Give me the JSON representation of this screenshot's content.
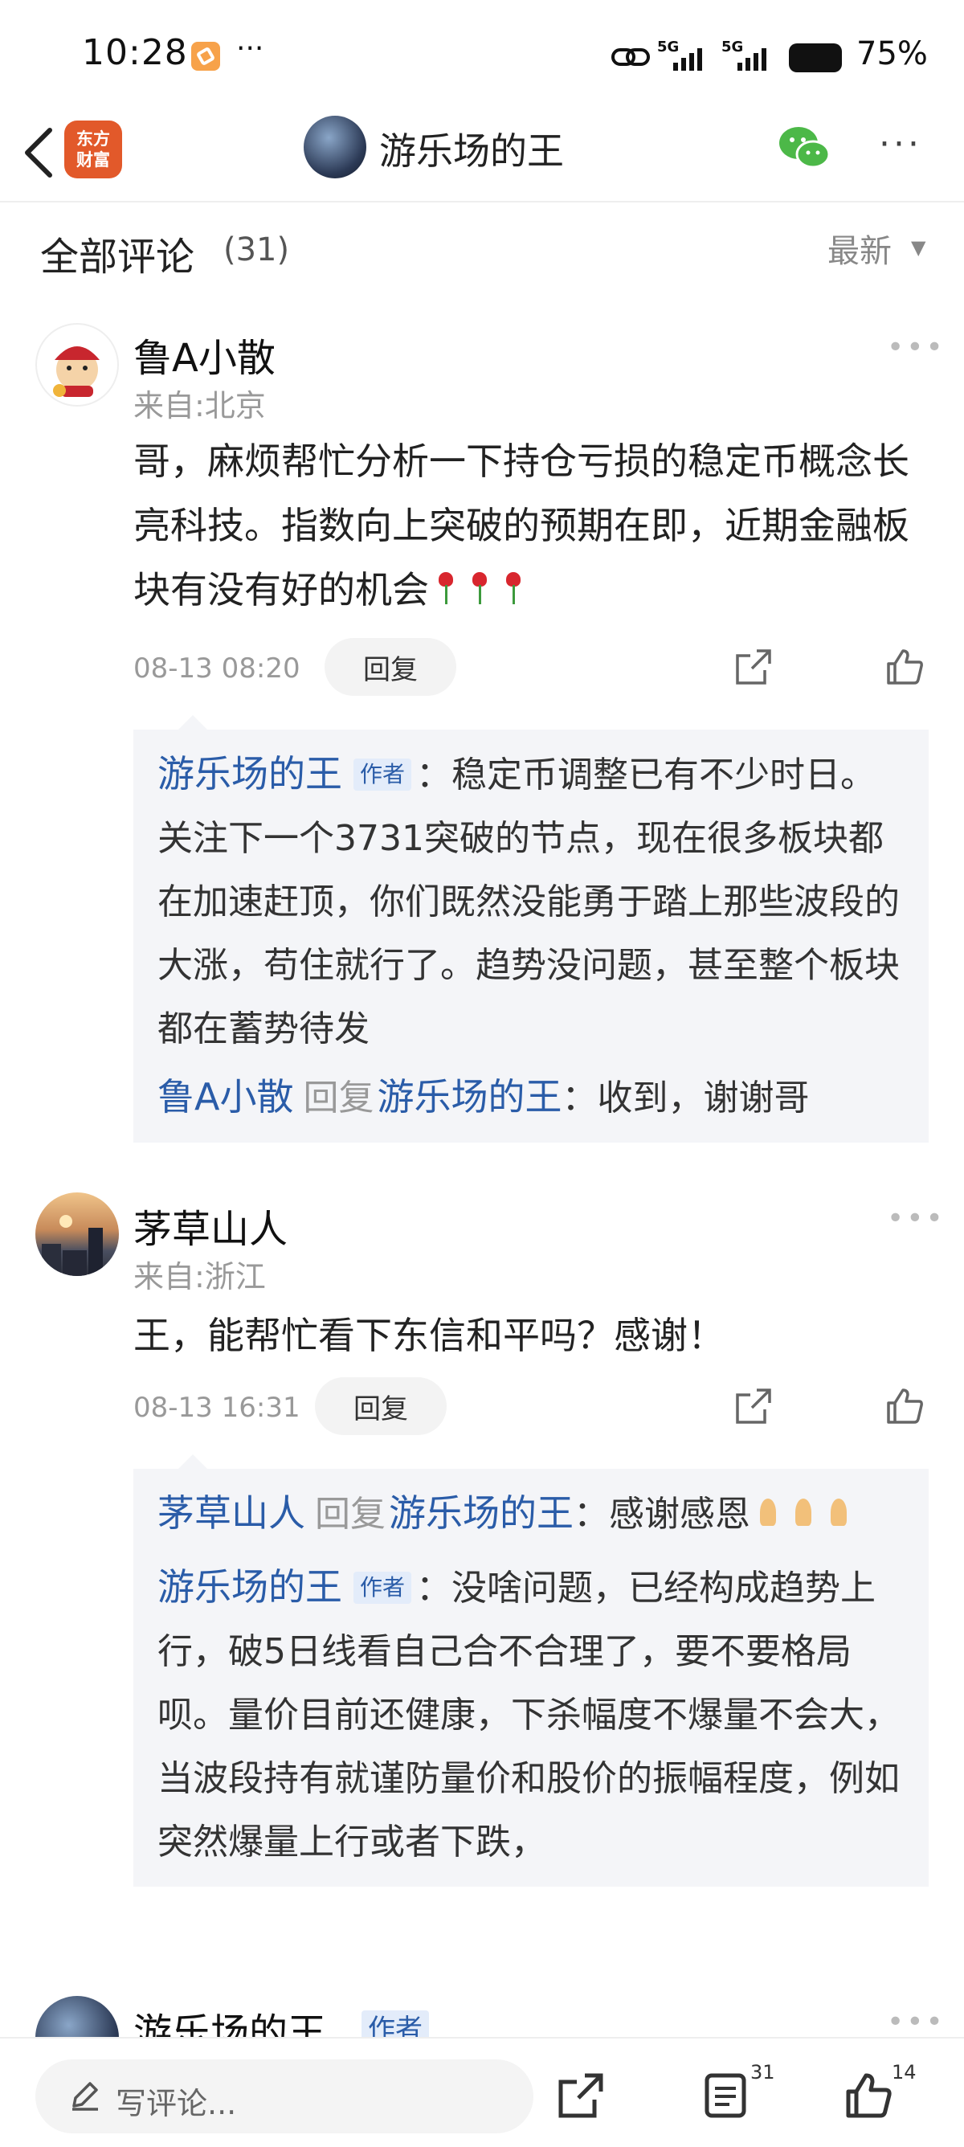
{
  "status_bar": {
    "time": "10:28",
    "more": "···",
    "signal1": "5G",
    "signal2": "5G",
    "battery": "75%"
  },
  "nav": {
    "logo_line1": "东方",
    "logo_line2": "财富",
    "title": "游乐场的王",
    "more": "···"
  },
  "section": {
    "title": "全部评论",
    "count": "(31)",
    "sort": "最新"
  },
  "comments": [
    {
      "name": "鲁A小散",
      "location": "来自:北京",
      "text": "哥，麻烦帮忙分析一下持仓亏损的稳定币概念长亮科技。指数向上突破的预期在即，近期金融板块有没有好的机会",
      "time": "08-13 08:20",
      "reply_label": "回复",
      "replies": [
        {
          "name": "游乐场的王",
          "tag": "作者",
          "text": "：稳定币调整已有不少时日。关注下一个3731突破的节点，现在很多板块都在加速赶顶，你们既然没能勇于踏上那些波段的大涨，苟住就行了。趋势没问题，甚至整个板块都在蓄势待发"
        },
        {
          "name": "鲁A小散",
          "reply_word": "回复",
          "target": "游乐场的王",
          "text": "：收到，谢谢哥"
        }
      ]
    },
    {
      "name": "茅草山人",
      "location": "来自:浙江",
      "text": "王，能帮忙看下东信和平吗？感谢！",
      "time": "08-13 16:31",
      "reply_label": "回复",
      "replies": [
        {
          "name": "茅草山人",
          "reply_word": "回复",
          "target": "游乐场的王",
          "text": "：感谢感恩"
        },
        {
          "name": "游乐场的王",
          "tag": "作者",
          "text": "：没啥问题，已经构成趋势上行，破5日线看自己合不合理了，要不要格局呗。量价目前还健康，下杀幅度不爆量不会大，当波段持有就谨防量价和股价的振幅程度，例如突然爆量上行或者下跌，"
        }
      ]
    },
    {
      "name": "游乐场的王",
      "tag": "作者"
    }
  ],
  "bottom_bar": {
    "write_placeholder": "写评论...",
    "comment_count": "31",
    "like_count": "14"
  }
}
